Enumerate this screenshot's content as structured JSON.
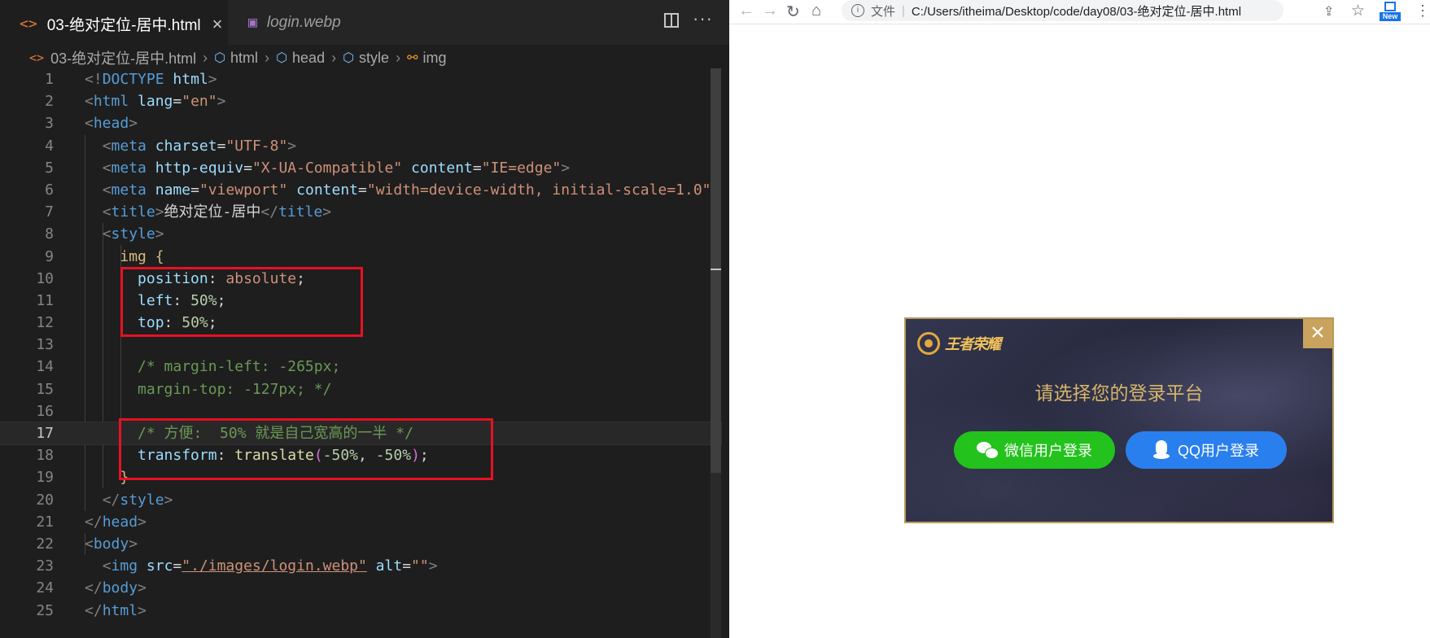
{
  "editor": {
    "tabs": [
      {
        "label": "03-绝对定位-居中.html",
        "icon": "html-file-icon",
        "active": true
      },
      {
        "label": "login.webp",
        "icon": "image-file-icon",
        "active": false
      }
    ],
    "close_glyph": "×",
    "more_glyph": "···",
    "breadcrumb": [
      "03-绝对定位-居中.html",
      "html",
      "head",
      "style",
      "img"
    ],
    "line_numbers": [
      "1",
      "2",
      "3",
      "4",
      "5",
      "6",
      "7",
      "8",
      "9",
      "10",
      "11",
      "12",
      "13",
      "14",
      "15",
      "16",
      "17",
      "18",
      "19",
      "20",
      "21",
      "22",
      "23",
      "24",
      "25"
    ],
    "code": {
      "l1": {
        "open": "<!",
        "kw": "DOCTYPE",
        "val": "html",
        "close": ">"
      },
      "l2": {
        "open": "<",
        "tag": "html",
        "attr": "lang",
        "eq": "=",
        "val": "\"en\"",
        "close": ">"
      },
      "l3": {
        "open": "<",
        "tag": "head",
        "close": ">"
      },
      "l4": {
        "open": "<",
        "tag": "meta",
        "attr": "charset",
        "eq": "=",
        "val": "\"UTF-8\"",
        "close": ">"
      },
      "l5": {
        "open": "<",
        "tag": "meta",
        "attr1": "http-equiv",
        "eq": "=",
        "val1": "\"X-UA-Compatible\"",
        "attr2": "content",
        "val2": "\"IE=edge\"",
        "close": ">"
      },
      "l6": {
        "open": "<",
        "tag": "meta",
        "attr1": "name",
        "eq": "=",
        "val1": "\"viewport\"",
        "attr2": "content",
        "val2": "\"width=device-width, initial-scale=1.0\"",
        "close": ">"
      },
      "l7": {
        "open": "<",
        "tag": "title",
        "close": ">",
        "text": "绝对定位-居中",
        "end_open": "</",
        "end_close": ">"
      },
      "l8": {
        "open": "<",
        "tag": "style",
        "close": ">"
      },
      "l9": {
        "selector": "img",
        "brace": "{"
      },
      "l10": {
        "prop": "position",
        "colon": ":",
        "value": "absolute",
        "semi": ";"
      },
      "l11": {
        "prop": "left",
        "colon": ":",
        "num": "50%",
        "semi": ";"
      },
      "l12": {
        "prop": "top",
        "colon": ":",
        "num": "50%",
        "semi": ";"
      },
      "l14": "/* margin-left: -265px;",
      "l15": "margin-top: -127px; */",
      "l17": "/* 方便:  50% 就是自己宽高的一半 */",
      "l18": {
        "prop": "transform",
        "colon": ":",
        "fn": "translate",
        "paren_open": "(",
        "arg1": "-50%",
        "comma": ", ",
        "arg2": "-50%",
        "paren_close": ")",
        "semi": ";"
      },
      "l19": {
        "brace": "}"
      },
      "l20": {
        "open": "</",
        "tag": "style",
        "close": ">"
      },
      "l21": {
        "open": "</",
        "tag": "head",
        "close": ">"
      },
      "l22": {
        "open": "<",
        "tag": "body",
        "close": ">"
      },
      "l23": {
        "open": "<",
        "tag": "img",
        "attr1": "src",
        "eq": "=",
        "val1": "\"./images/login.webp\"",
        "attr2": "alt",
        "val2": "\"\"",
        "close": ">"
      },
      "l24": {
        "open": "</",
        "tag": "body",
        "close": ">"
      },
      "l25": {
        "open": "</",
        "tag": "html",
        "close": ">"
      }
    }
  },
  "browser": {
    "file_label": "文件",
    "url_separator": "|",
    "url": "C:/Users/itheima/Desktop/code/day08/03-绝对定位-居中.html",
    "ext_badge": "New",
    "popup": {
      "logo_text": "王者荣耀",
      "title": "请选择您的登录平台",
      "wechat_label": "微信用户登录",
      "qq_label": "QQ用户登录",
      "close_glyph": "×"
    }
  },
  "colors": {
    "highlight_box": "#e81123",
    "wechat_green": "#23c21d",
    "qq_blue": "#2a7fee",
    "popup_gold": "#c9a35d"
  }
}
